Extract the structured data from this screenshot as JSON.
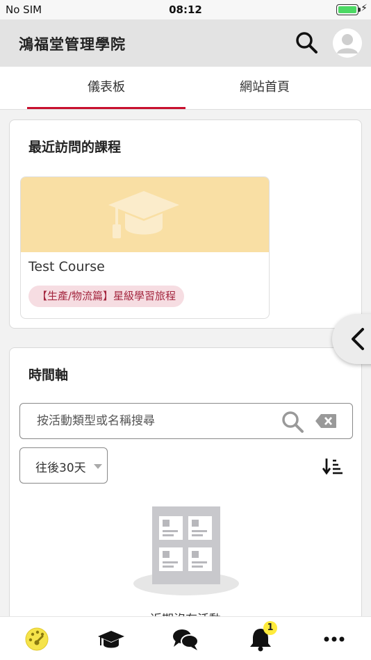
{
  "status_bar": {
    "carrier": "No SIM",
    "time": "08:12",
    "battery_level": 1.0,
    "battery_color": "#4cd964"
  },
  "header": {
    "title": "鴻福堂管理學院",
    "background": "#e3e3e3"
  },
  "tabs": [
    {
      "label": "儀表板",
      "active": true
    },
    {
      "label": "網站首頁",
      "active": false
    }
  ],
  "accent_color": "#c8102e",
  "recent_courses": {
    "title": "最近訪問的課程",
    "courses": [
      {
        "name": "Test Course",
        "category": "【生產/物流篇】星級學習旅程",
        "icon": "graduation-cap-icon",
        "banner_color": "#f9dfa4"
      }
    ]
  },
  "timeline": {
    "title": "時間軸",
    "search_placeholder": "按活動類型或名稱搜尋",
    "filter_value": "往後30天",
    "empty_text": "近期沒有活動"
  },
  "bottom_nav": {
    "items": [
      {
        "icon": "dashboard-icon",
        "active": true
      },
      {
        "icon": "graduation-cap-icon",
        "active": false
      },
      {
        "icon": "chat-bubbles-icon",
        "active": false
      },
      {
        "icon": "bell-icon",
        "active": false,
        "badge": "1"
      },
      {
        "icon": "more-icon",
        "active": false
      }
    ],
    "active_color": "#f5e34a"
  }
}
